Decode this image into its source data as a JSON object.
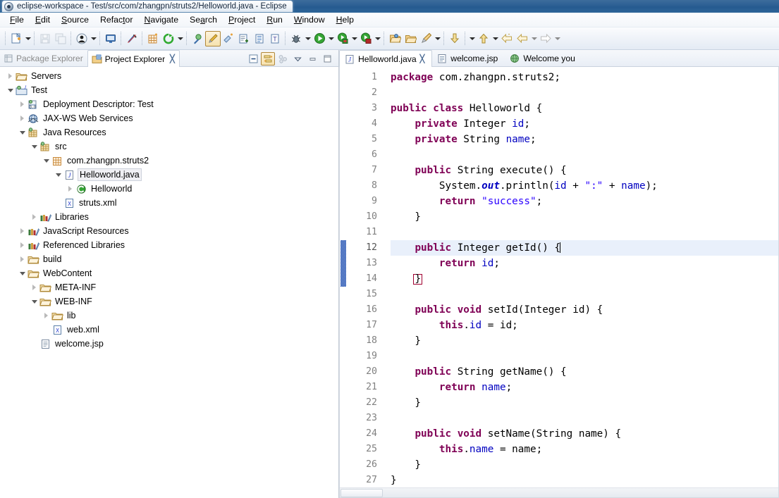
{
  "window": {
    "title": "eclipse-workspace - Test/src/com/zhangpn/struts2/Helloworld.java - Eclipse",
    "app_icon": "eclipse-icon"
  },
  "menubar": {
    "items": [
      {
        "label": "File"
      },
      {
        "label": "Edit"
      },
      {
        "label": "Source"
      },
      {
        "label": "Refactor"
      },
      {
        "label": "Navigate"
      },
      {
        "label": "Search"
      },
      {
        "label": "Project"
      },
      {
        "label": "Run"
      },
      {
        "label": "Window"
      },
      {
        "label": "Help"
      }
    ]
  },
  "toolbar": {
    "buttons": [
      {
        "name": "new-wizard",
        "icon": "new-file-icon",
        "dropdown": true
      },
      {
        "name": "save",
        "icon": "save-icon",
        "disabled": true
      },
      {
        "name": "save-all",
        "icon": "save-all-icon",
        "disabled": true
      },
      {
        "name": "new-user",
        "icon": "person-icon",
        "dropdown": true
      },
      {
        "name": "open-console",
        "icon": "console-icon"
      },
      {
        "name": "toggle-link",
        "icon": "link-broken-icon"
      },
      {
        "name": "new-package",
        "icon": "package-icon"
      },
      {
        "name": "refresh-server",
        "icon": "refresh-green-icon",
        "dropdown": true
      },
      {
        "name": "open-type",
        "icon": "open-type-icon"
      },
      {
        "name": "edit-highlight",
        "icon": "highlighter-icon",
        "pressed": true
      },
      {
        "name": "external-tools",
        "icon": "external-tools-icon"
      },
      {
        "name": "new-java-class",
        "icon": "new-class-icon"
      },
      {
        "name": "new-java-interface",
        "icon": "new-interface-icon"
      },
      {
        "name": "new-annotation",
        "icon": "annotation-icon"
      },
      {
        "name": "debug",
        "icon": "bug-icon",
        "dropdown": true
      },
      {
        "name": "run",
        "icon": "run-green-icon",
        "dropdown": true
      },
      {
        "name": "run-server",
        "icon": "run-server-icon",
        "dropdown": true
      },
      {
        "name": "stop-server",
        "icon": "stop-server-icon",
        "dropdown": true
      },
      {
        "name": "open-resource",
        "icon": "open-folder-icon"
      },
      {
        "name": "open-task",
        "icon": "task-folder-icon"
      },
      {
        "name": "search",
        "icon": "pencil-search-icon",
        "dropdown": true
      },
      {
        "name": "next-annotation",
        "icon": "arrow-down-yellow-icon",
        "dropdown": true
      },
      {
        "name": "previous-annotation",
        "icon": "arrow-up-yellow-icon",
        "dropdown": true
      },
      {
        "name": "back",
        "icon": "back-arrow-icon"
      },
      {
        "name": "back-history",
        "icon": "back-arrow-outline-icon",
        "dropdown": true
      },
      {
        "name": "forward",
        "icon": "forward-arrow-icon",
        "dropdown": true
      }
    ]
  },
  "left_view": {
    "tabs": [
      {
        "label": "Package Explorer",
        "icon": "package-explorer-icon",
        "active": false,
        "closable": false
      },
      {
        "label": "Project Explorer",
        "icon": "project-explorer-icon",
        "active": true,
        "closable": true,
        "close_glyph": "╳"
      }
    ],
    "toolbar": [
      {
        "name": "collapse-all-button",
        "icon": "collapse-all-icon",
        "pressed": false
      },
      {
        "name": "link-with-editor-button",
        "icon": "link-editor-icon",
        "pressed": true
      },
      {
        "name": "view-menu-filters-button",
        "icon": "filters-icon",
        "pressed": false
      },
      {
        "name": "view-menu-button",
        "icon": "chevron-down-icon",
        "pressed": false
      },
      {
        "name": "minimize-view-button",
        "icon": "minimize-icon",
        "pressed": false
      },
      {
        "name": "maximize-view-button",
        "icon": "maximize-icon",
        "pressed": false
      }
    ],
    "tree": [
      {
        "label": "Servers",
        "indent": 0,
        "twist": "closed",
        "icon": "folder-server-icon",
        "selected": false
      },
      {
        "label": "Test",
        "indent": 0,
        "twist": "open",
        "icon": "java-project-icon",
        "selected": false
      },
      {
        "label": "Deployment Descriptor: Test",
        "indent": 1,
        "twist": "closed",
        "icon": "deployment-descriptor-icon",
        "selected": false
      },
      {
        "label": "JAX-WS Web Services",
        "indent": 1,
        "twist": "closed",
        "icon": "web-services-icon",
        "selected": false
      },
      {
        "label": "Java Resources",
        "indent": 1,
        "twist": "open",
        "icon": "java-resources-icon",
        "selected": false
      },
      {
        "label": "src",
        "indent": 2,
        "twist": "open",
        "icon": "source-folder-icon",
        "selected": false
      },
      {
        "label": "com.zhangpn.struts2",
        "indent": 3,
        "twist": "open",
        "icon": "package-icon",
        "selected": false
      },
      {
        "label": "Helloworld.java",
        "indent": 4,
        "twist": "open",
        "icon": "java-file-icon",
        "selected": true
      },
      {
        "label": "Helloworld",
        "indent": 5,
        "twist": "closed",
        "icon": "class-icon",
        "selected": false
      },
      {
        "label": "struts.xml",
        "indent": 4,
        "twist": "none",
        "icon": "xml-file-icon",
        "selected": false
      },
      {
        "label": "Libraries",
        "indent": 2,
        "twist": "closed",
        "icon": "libraries-icon",
        "selected": false
      },
      {
        "label": "JavaScript Resources",
        "indent": 1,
        "twist": "closed",
        "icon": "libraries-icon",
        "selected": false
      },
      {
        "label": "Referenced Libraries",
        "indent": 1,
        "twist": "closed",
        "icon": "libraries-icon",
        "selected": false
      },
      {
        "label": "build",
        "indent": 1,
        "twist": "closed",
        "icon": "folder-icon",
        "selected": false
      },
      {
        "label": "WebContent",
        "indent": 1,
        "twist": "open",
        "icon": "folder-icon",
        "selected": false
      },
      {
        "label": "META-INF",
        "indent": 2,
        "twist": "closed",
        "icon": "folder-icon",
        "selected": false
      },
      {
        "label": "WEB-INF",
        "indent": 2,
        "twist": "open",
        "icon": "folder-icon",
        "selected": false
      },
      {
        "label": "lib",
        "indent": 3,
        "twist": "closed",
        "icon": "folder-icon",
        "selected": false
      },
      {
        "label": "web.xml",
        "indent": 3,
        "twist": "none",
        "icon": "xml-file-icon",
        "selected": false
      },
      {
        "label": "welcome.jsp",
        "indent": 2,
        "twist": "none",
        "icon": "jsp-file-icon",
        "selected": false
      }
    ]
  },
  "editor": {
    "tabs": [
      {
        "label": "Helloworld.java",
        "icon": "java-file-icon",
        "active": true,
        "closable": true,
        "close_glyph": "╳"
      },
      {
        "label": "welcome.jsp",
        "icon": "jsp-file-icon",
        "active": false,
        "closable": false
      },
      {
        "label": "Welcome you",
        "icon": "browser-icon",
        "active": false,
        "closable": false
      }
    ],
    "current_line": 12,
    "change_bar_lines": [
      12,
      13,
      14
    ],
    "lines": [
      {
        "n": 1,
        "fold": false,
        "current": false,
        "tokens": [
          {
            "t": "package",
            "c": "kw"
          },
          {
            "t": " com.zhangpn.struts2;",
            "c": "plain"
          }
        ]
      },
      {
        "n": 2,
        "fold": false,
        "current": false,
        "tokens": []
      },
      {
        "n": 3,
        "fold": false,
        "current": false,
        "tokens": [
          {
            "t": "public class",
            "c": "kw"
          },
          {
            "t": " Helloworld {",
            "c": "plain"
          }
        ]
      },
      {
        "n": 4,
        "fold": false,
        "current": false,
        "tokens": [
          {
            "t": "    ",
            "c": "plain"
          },
          {
            "t": "private",
            "c": "kw"
          },
          {
            "t": " Integer ",
            "c": "plain"
          },
          {
            "t": "id",
            "c": "fld"
          },
          {
            "t": ";",
            "c": "plain"
          }
        ]
      },
      {
        "n": 5,
        "fold": false,
        "current": false,
        "tokens": [
          {
            "t": "    ",
            "c": "plain"
          },
          {
            "t": "private",
            "c": "kw"
          },
          {
            "t": " String ",
            "c": "plain"
          },
          {
            "t": "name",
            "c": "fld"
          },
          {
            "t": ";",
            "c": "plain"
          }
        ]
      },
      {
        "n": 6,
        "fold": false,
        "current": false,
        "tokens": []
      },
      {
        "n": 7,
        "fold": true,
        "current": false,
        "tokens": [
          {
            "t": "    ",
            "c": "plain"
          },
          {
            "t": "public",
            "c": "kw"
          },
          {
            "t": " String execute() {",
            "c": "plain"
          }
        ]
      },
      {
        "n": 8,
        "fold": false,
        "current": false,
        "tokens": [
          {
            "t": "        System.",
            "c": "plain"
          },
          {
            "t": "out",
            "c": "stat"
          },
          {
            "t": ".println(",
            "c": "plain"
          },
          {
            "t": "id",
            "c": "fld"
          },
          {
            "t": " + ",
            "c": "plain"
          },
          {
            "t": "\":\"",
            "c": "str"
          },
          {
            "t": " + ",
            "c": "plain"
          },
          {
            "t": "name",
            "c": "fld"
          },
          {
            "t": ");",
            "c": "plain"
          }
        ]
      },
      {
        "n": 9,
        "fold": false,
        "current": false,
        "tokens": [
          {
            "t": "        ",
            "c": "plain"
          },
          {
            "t": "return",
            "c": "kw"
          },
          {
            "t": " ",
            "c": "plain"
          },
          {
            "t": "\"success\"",
            "c": "str"
          },
          {
            "t": ";",
            "c": "plain"
          }
        ]
      },
      {
        "n": 10,
        "fold": false,
        "current": false,
        "tokens": [
          {
            "t": "    }",
            "c": "plain"
          }
        ]
      },
      {
        "n": 11,
        "fold": false,
        "current": false,
        "tokens": []
      },
      {
        "n": 12,
        "fold": true,
        "current": true,
        "tokens": [
          {
            "t": "    ",
            "c": "plain"
          },
          {
            "t": "public",
            "c": "kw"
          },
          {
            "t": " Integer getId() {",
            "c": "plain"
          },
          {
            "t": "|",
            "c": "caret"
          }
        ]
      },
      {
        "n": 13,
        "fold": false,
        "current": false,
        "tokens": [
          {
            "t": "        ",
            "c": "plain"
          },
          {
            "t": "return",
            "c": "kw"
          },
          {
            "t": " ",
            "c": "plain"
          },
          {
            "t": "id",
            "c": "fld"
          },
          {
            "t": ";",
            "c": "plain"
          }
        ]
      },
      {
        "n": 14,
        "fold": false,
        "current": false,
        "tokens": [
          {
            "t": "    ",
            "c": "plain"
          },
          {
            "t": "}",
            "c": "bracketbox"
          }
        ]
      },
      {
        "n": 15,
        "fold": false,
        "current": false,
        "tokens": []
      },
      {
        "n": 16,
        "fold": true,
        "current": false,
        "tokens": [
          {
            "t": "    ",
            "c": "plain"
          },
          {
            "t": "public void",
            "c": "kw"
          },
          {
            "t": " setId(Integer ",
            "c": "plain"
          },
          {
            "t": "id",
            "c": "plain"
          },
          {
            "t": ") {",
            "c": "plain"
          }
        ]
      },
      {
        "n": 17,
        "fold": false,
        "current": false,
        "tokens": [
          {
            "t": "        ",
            "c": "plain"
          },
          {
            "t": "this",
            "c": "kw"
          },
          {
            "t": ".",
            "c": "plain"
          },
          {
            "t": "id",
            "c": "fld"
          },
          {
            "t": " = id;",
            "c": "plain"
          }
        ]
      },
      {
        "n": 18,
        "fold": false,
        "current": false,
        "tokens": [
          {
            "t": "    }",
            "c": "plain"
          }
        ]
      },
      {
        "n": 19,
        "fold": false,
        "current": false,
        "tokens": []
      },
      {
        "n": 20,
        "fold": true,
        "current": false,
        "tokens": [
          {
            "t": "    ",
            "c": "plain"
          },
          {
            "t": "public",
            "c": "kw"
          },
          {
            "t": " String getName() {",
            "c": "plain"
          }
        ]
      },
      {
        "n": 21,
        "fold": false,
        "current": false,
        "tokens": [
          {
            "t": "        ",
            "c": "plain"
          },
          {
            "t": "return",
            "c": "kw"
          },
          {
            "t": " ",
            "c": "plain"
          },
          {
            "t": "name",
            "c": "fld"
          },
          {
            "t": ";",
            "c": "plain"
          }
        ]
      },
      {
        "n": 22,
        "fold": false,
        "current": false,
        "tokens": [
          {
            "t": "    }",
            "c": "plain"
          }
        ]
      },
      {
        "n": 23,
        "fold": false,
        "current": false,
        "tokens": []
      },
      {
        "n": 24,
        "fold": true,
        "current": false,
        "tokens": [
          {
            "t": "    ",
            "c": "plain"
          },
          {
            "t": "public void",
            "c": "kw"
          },
          {
            "t": " setName(String name) {",
            "c": "plain"
          }
        ]
      },
      {
        "n": 25,
        "fold": false,
        "current": false,
        "tokens": [
          {
            "t": "        ",
            "c": "plain"
          },
          {
            "t": "this",
            "c": "kw"
          },
          {
            "t": ".",
            "c": "plain"
          },
          {
            "t": "name",
            "c": "fld"
          },
          {
            "t": " = name;",
            "c": "plain"
          }
        ]
      },
      {
        "n": 26,
        "fold": false,
        "current": false,
        "tokens": [
          {
            "t": "    }",
            "c": "plain"
          }
        ]
      },
      {
        "n": 27,
        "fold": false,
        "current": false,
        "tokens": [
          {
            "t": "}",
            "c": "plain"
          }
        ]
      }
    ]
  },
  "colors": {
    "keyword": "#7f0055",
    "string": "#2a00ff",
    "field": "#0000c0",
    "current_line_bg": "#e9f0fb",
    "title_bar": "#2c5f93",
    "change_bar": "#1b3fa0"
  }
}
